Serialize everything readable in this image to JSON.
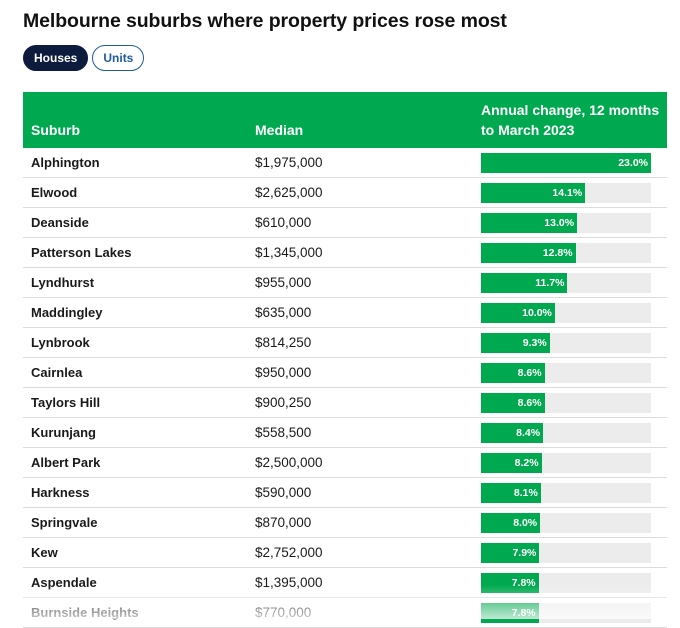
{
  "title": "Melbourne suburbs where property prices rose most",
  "tabs": [
    {
      "label": "Houses",
      "active": true
    },
    {
      "label": "Units",
      "active": false
    }
  ],
  "table": {
    "headers": {
      "suburb": "Suburb",
      "median": "Median",
      "change": "Annual change, 12 months to March 2023"
    },
    "max_change": 23.0,
    "rows": [
      {
        "suburb": "Alphington",
        "median": "$1,975,000",
        "change": 23.0,
        "change_label": "23.0%"
      },
      {
        "suburb": "Elwood",
        "median": "$2,625,000",
        "change": 14.1,
        "change_label": "14.1%"
      },
      {
        "suburb": "Deanside",
        "median": "$610,000",
        "change": 13.0,
        "change_label": "13.0%"
      },
      {
        "suburb": "Patterson Lakes",
        "median": "$1,345,000",
        "change": 12.8,
        "change_label": "12.8%"
      },
      {
        "suburb": "Lyndhurst",
        "median": "$955,000",
        "change": 11.7,
        "change_label": "11.7%"
      },
      {
        "suburb": "Maddingley",
        "median": "$635,000",
        "change": 10.0,
        "change_label": "10.0%"
      },
      {
        "suburb": "Lynbrook",
        "median": "$814,250",
        "change": 9.3,
        "change_label": "9.3%"
      },
      {
        "suburb": "Cairnlea",
        "median": "$950,000",
        "change": 8.6,
        "change_label": "8.6%"
      },
      {
        "suburb": "Taylors Hill",
        "median": "$900,250",
        "change": 8.6,
        "change_label": "8.6%"
      },
      {
        "suburb": "Kurunjang",
        "median": "$558,500",
        "change": 8.4,
        "change_label": "8.4%"
      },
      {
        "suburb": "Albert Park",
        "median": "$2,500,000",
        "change": 8.2,
        "change_label": "8.2%"
      },
      {
        "suburb": "Harkness",
        "median": "$590,000",
        "change": 8.1,
        "change_label": "8.1%"
      },
      {
        "suburb": "Springvale",
        "median": "$870,000",
        "change": 8.0,
        "change_label": "8.0%"
      },
      {
        "suburb": "Kew",
        "median": "$2,752,000",
        "change": 7.9,
        "change_label": "7.9%"
      },
      {
        "suburb": "Aspendale",
        "median": "$1,395,000",
        "change": 7.8,
        "change_label": "7.8%"
      },
      {
        "suburb": "Burnside Heights",
        "median": "$770,000",
        "change": 7.8,
        "change_label": "7.8%"
      }
    ]
  },
  "colors": {
    "accent_green": "#00a94f",
    "tab_active_bg": "#0d1b3d",
    "tab_inactive_border": "#1f5ba0",
    "bar_track": "#ececec"
  }
}
